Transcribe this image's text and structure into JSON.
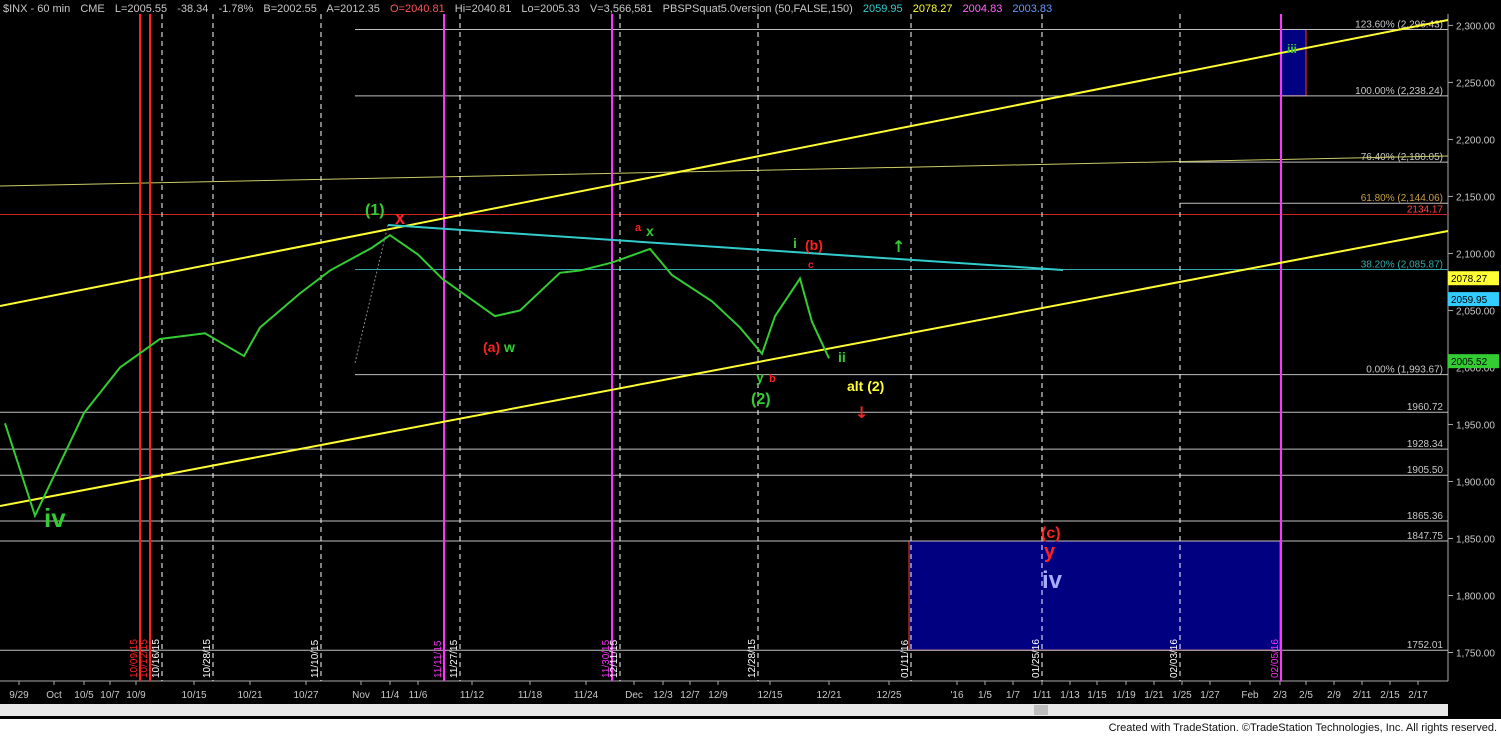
{
  "header": {
    "symbol": "$INX - 60 min",
    "exchange": "CME",
    "last": "L=2005.55",
    "change": "-38.34",
    "pct": "-1.78%",
    "bid": "B=2002.55",
    "ask": "A=2012.35",
    "open": "O=2040.81",
    "high": "Hi=2040.81",
    "low": "Lo=2005.33",
    "volume": "V=3,566,581",
    "indicator": "PBSPSquat5.0version (50,FALSE,150)",
    "ind_v1": "2059.95",
    "ind_v2": "2078.27",
    "ind_v3": "2004.83",
    "ind_v4": "2003.83"
  },
  "footer": {
    "credit": "Created with TradeStation. ©TradeStation Technologies, Inc. All rights reserved."
  },
  "colors": {
    "background": "#000000",
    "price": "#33cc33",
    "channel": "#ffff33",
    "trendline": "#33cccc",
    "fib": "#c0c0c0",
    "red_marker": "#ff2222",
    "magenta": "#ff33ff",
    "target_box": "#000080"
  },
  "chart_data": {
    "type": "line",
    "symbol": "$INX",
    "interval": "60 min",
    "ylim": [
      1725,
      2310
    ],
    "y_ticks": [
      1750,
      1800,
      1850,
      1900,
      1950,
      2000,
      2050,
      2100,
      2150,
      2200,
      2250,
      2300
    ],
    "y_tick_labels": [
      "1,750.00",
      "1,800.00",
      "1,850.00",
      "1,900.00",
      "1,950.00",
      "2,000.00",
      "2,050.00",
      "2,100.00",
      "2,150.00",
      "2,200.00",
      "2,250.00",
      "2,300.00"
    ],
    "x_tick_labels": [
      "9/29",
      "Oct",
      "10/5",
      "10/7",
      "10/9",
      "10/15",
      "10/21",
      "10/27",
      "Nov",
      "11/4",
      "11/6",
      "11/12",
      "11/18",
      "11/24",
      "Dec",
      "12/3",
      "12/7",
      "12/9",
      "12/15",
      "12/21",
      "12/25",
      "'16",
      "1/5",
      "1/7",
      "1/11",
      "1/13",
      "1/15",
      "1/19",
      "1/21",
      "1/25",
      "1/27",
      "Feb",
      "2/3",
      "2/5",
      "2/9",
      "2/11",
      "2/15",
      "2/17"
    ],
    "price_series": {
      "name": "$INX",
      "x": [
        "9/29",
        "10/2",
        "10/5",
        "10/8",
        "10/12",
        "10/16",
        "10/20",
        "10/22",
        "10/26",
        "10/29",
        "11/3",
        "11/4",
        "11/6",
        "11/9",
        "11/12",
        "11/16",
        "11/20",
        "11/23",
        "11/27",
        "12/2",
        "12/3",
        "12/8",
        "12/10",
        "12/14",
        "12/15",
        "12/17",
        "12/18",
        "12/21"
      ],
      "y": [
        1951,
        1870,
        1960,
        2000,
        2025,
        2030,
        2010,
        2035,
        2065,
        2085,
        2105,
        2116,
        2099,
        2078,
        2045,
        2050,
        2083,
        2085,
        2092,
        2104,
        2081,
        2058,
        2035,
        2012,
        2045,
        2078,
        2040,
        2008
      ]
    },
    "current_price": 2005.52,
    "price_flags": [
      2078.27,
      2059.95,
      2005.52
    ],
    "fib_levels": [
      {
        "label": "123.60% (2,296.43)",
        "value": 2296.43
      },
      {
        "label": "100.00% (2,238.24)",
        "value": 2238.24
      },
      {
        "label": "76.40% (2,180.05)",
        "value": 2180.05
      },
      {
        "label": "61.80% (2,144.06)",
        "value": 2144.06
      },
      {
        "label": "38.20% (2,085.87)",
        "value": 2085.87
      },
      {
        "label": "0.00% (1,993.67)",
        "value": 1993.67
      }
    ],
    "price_levels": [
      {
        "label": "2134.17",
        "value": 2134.17
      },
      {
        "label": "1960.72",
        "value": 1960.72
      },
      {
        "label": "1928.34",
        "value": 1928.34
      },
      {
        "label": "1905.50",
        "value": 1905.5
      },
      {
        "label": "1865.36",
        "value": 1865.36
      },
      {
        "label": "1847.75",
        "value": 1847.75
      },
      {
        "label": "1752.01",
        "value": 1752.01
      }
    ],
    "date_markers": [
      "10/09/15",
      "10/12/15",
      "10/16/15",
      "10/28/15",
      "11/10/15",
      "11/11/15",
      "11/27/15",
      "11/30/15",
      "12/11/15",
      "12/28/15",
      "01/11/16",
      "01/25/16",
      "02/03/16",
      "02/05/16"
    ],
    "wave_labels": [
      {
        "text": "iv",
        "color": "#33cc33"
      },
      {
        "text": "(1)",
        "color": "#33cc33"
      },
      {
        "text": "x",
        "color": "#ff2222"
      },
      {
        "text": "(a)",
        "color": "#ff2222"
      },
      {
        "text": "w",
        "color": "#33cc33"
      },
      {
        "text": "a",
        "color": "#ff2222"
      },
      {
        "text": "x",
        "color": "#33cc33"
      },
      {
        "text": "i",
        "color": "#33cc33"
      },
      {
        "text": "(b)",
        "color": "#ff2222"
      },
      {
        "text": "c",
        "color": "#ff2222"
      },
      {
        "text": "ii",
        "color": "#33cc33"
      },
      {
        "text": "y",
        "color": "#33cc33"
      },
      {
        "text": "b",
        "color": "#ff2222"
      },
      {
        "text": "(2)",
        "color": "#33cc33"
      },
      {
        "text": "alt (2)",
        "color": "#ffff33"
      },
      {
        "text": "iii",
        "color": "#33cc33"
      },
      {
        "text": "(c)",
        "color": "#ff2222"
      },
      {
        "text": "y",
        "color": "#ff2222"
      },
      {
        "text": "iv",
        "color": "#aaaaff"
      }
    ],
    "target_boxes": [
      {
        "name": "wave iv target",
        "y_top": 1847.75,
        "y_bottom": 1752.01
      },
      {
        "name": "wave iii target",
        "y_top": 2296.43,
        "y_bottom": 2238.24
      }
    ],
    "grid": false
  }
}
